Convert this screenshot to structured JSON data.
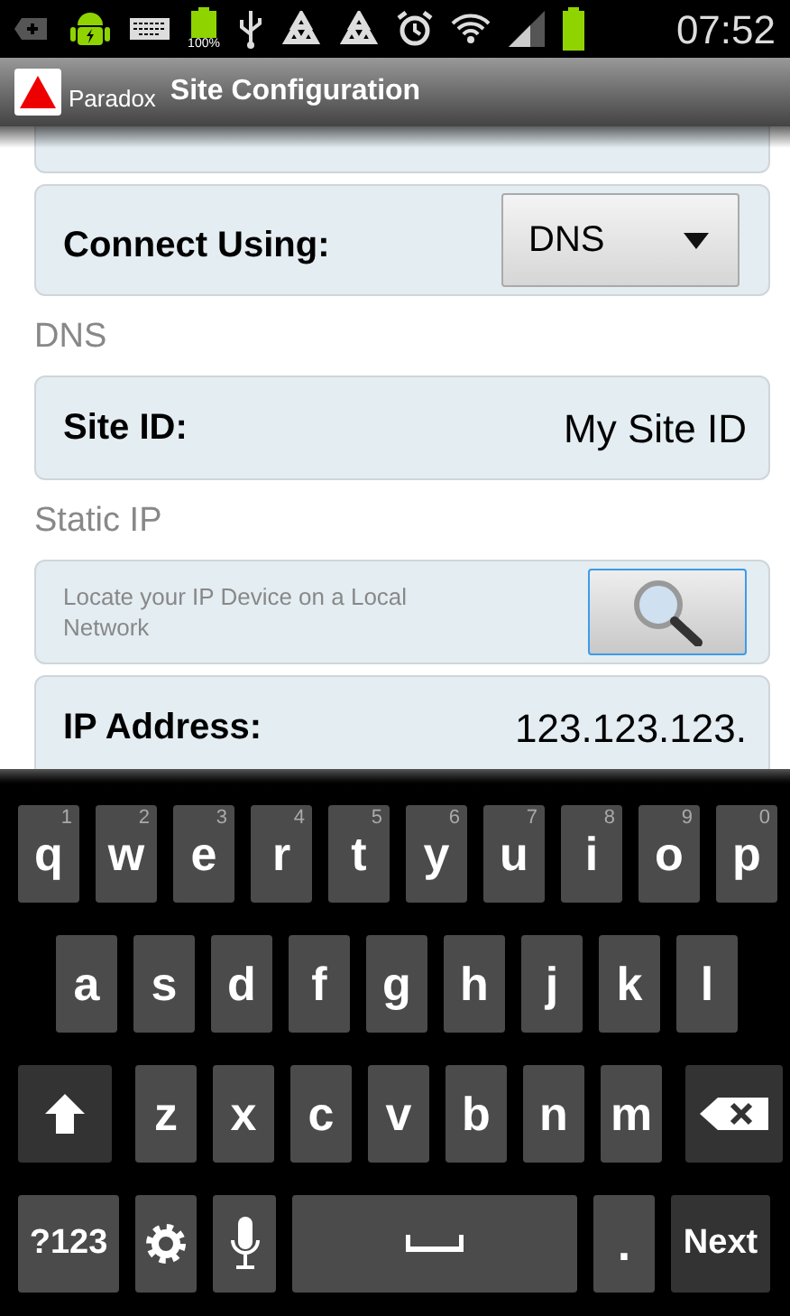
{
  "status_bar": {
    "battery_label": "100%",
    "time": "07:52"
  },
  "app_bar": {
    "app_name": "Paradox",
    "title": "Site Configuration"
  },
  "items": [
    {
      "kind": "dropdown",
      "label": "Connect Using:",
      "value": "DNS"
    },
    {
      "kind": "heading",
      "label": "DNS"
    },
    {
      "kind": "text",
      "label": "Site ID:",
      "value": "My Site ID"
    },
    {
      "kind": "heading",
      "label": "Static IP"
    },
    {
      "kind": "search",
      "label": "Locate your IP Device on a Local Network"
    },
    {
      "kind": "text",
      "label": "IP Address:",
      "value": "123.123.123."
    }
  ],
  "keyboard": [
    [
      {
        "kind": "letter",
        "label": "q",
        "hint": "1"
      },
      {
        "kind": "letter",
        "label": "w",
        "hint": "2"
      },
      {
        "kind": "letter",
        "label": "e",
        "hint": "3"
      },
      {
        "kind": "letter",
        "label": "r",
        "hint": "4"
      },
      {
        "kind": "letter",
        "label": "t",
        "hint": "5"
      },
      {
        "kind": "letter",
        "label": "y",
        "hint": "6"
      },
      {
        "kind": "letter",
        "label": "u",
        "hint": "7"
      },
      {
        "kind": "letter",
        "label": "i",
        "hint": "8"
      },
      {
        "kind": "letter",
        "label": "o",
        "hint": "9"
      },
      {
        "kind": "letter",
        "label": "p",
        "hint": "0"
      }
    ],
    [
      {
        "kind": "letter",
        "label": "a"
      },
      {
        "kind": "letter",
        "label": "s"
      },
      {
        "kind": "letter",
        "label": "d"
      },
      {
        "kind": "letter",
        "label": "f"
      },
      {
        "kind": "letter",
        "label": "g"
      },
      {
        "kind": "letter",
        "label": "h"
      },
      {
        "kind": "letter",
        "label": "j"
      },
      {
        "kind": "letter",
        "label": "k"
      },
      {
        "kind": "letter",
        "label": "l"
      }
    ],
    [
      {
        "kind": "shift"
      },
      {
        "kind": "letter",
        "label": "z"
      },
      {
        "kind": "letter",
        "label": "x"
      },
      {
        "kind": "letter",
        "label": "c"
      },
      {
        "kind": "letter",
        "label": "v"
      },
      {
        "kind": "letter",
        "label": "b"
      },
      {
        "kind": "letter",
        "label": "n"
      },
      {
        "kind": "letter",
        "label": "m"
      },
      {
        "kind": "backspace"
      }
    ],
    [
      {
        "kind": "symbols",
        "label": "?123"
      },
      {
        "kind": "settings"
      },
      {
        "kind": "mic"
      },
      {
        "kind": "space"
      },
      {
        "kind": "letter",
        "label": "."
      },
      {
        "kind": "action",
        "label": "Next"
      }
    ]
  ]
}
